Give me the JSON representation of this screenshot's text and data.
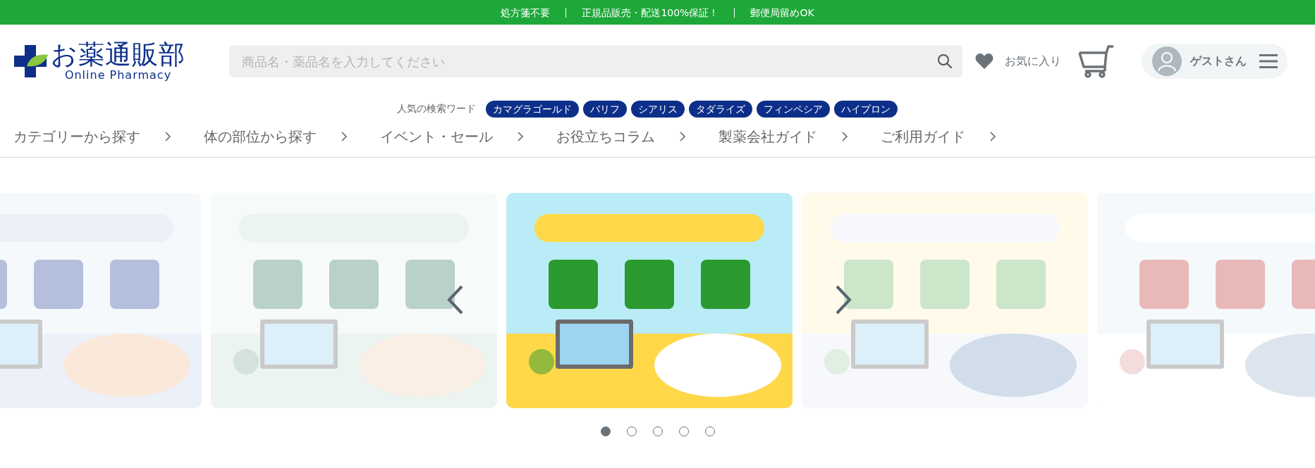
{
  "top_bar": {
    "messages": [
      "処方箋不要",
      "正規品販売・配送100%保証！",
      "郵便局留めOK"
    ]
  },
  "header": {
    "logo": {
      "title": "お薬通販部",
      "subtitle": "Online Pharmacy"
    },
    "search": {
      "placeholder": "商品名・薬品名を入力してください"
    },
    "favorites": "お気に入り",
    "user": "ゲストさん"
  },
  "popular_searches": {
    "label": "人気の検索ワード",
    "tags": [
      "カマグラゴールド",
      "バリフ",
      "シアリス",
      "タダライズ",
      "フィンペシア",
      "ハイプロン"
    ]
  },
  "nav": [
    {
      "label": "カテゴリーから探す"
    },
    {
      "label": "体の部位から探す"
    },
    {
      "label": "イベント・セール"
    },
    {
      "label": "お役立ちコラム"
    },
    {
      "label": "製薬会社ガイド"
    },
    {
      "label": "ご利用ガイド"
    }
  ],
  "carousel": {
    "slides": [
      {
        "kind": "picture",
        "selected": false
      },
      {
        "kind": "picture",
        "selected": false
      },
      {
        "kind": "picture",
        "selected": true
      },
      {
        "kind": "picture",
        "selected": false
      },
      {
        "kind": "picture",
        "selected": false
      }
    ],
    "dots": [
      {
        "selected": true
      },
      {
        "selected": false
      },
      {
        "selected": false
      },
      {
        "selected": false
      },
      {
        "selected": false
      }
    ]
  }
}
